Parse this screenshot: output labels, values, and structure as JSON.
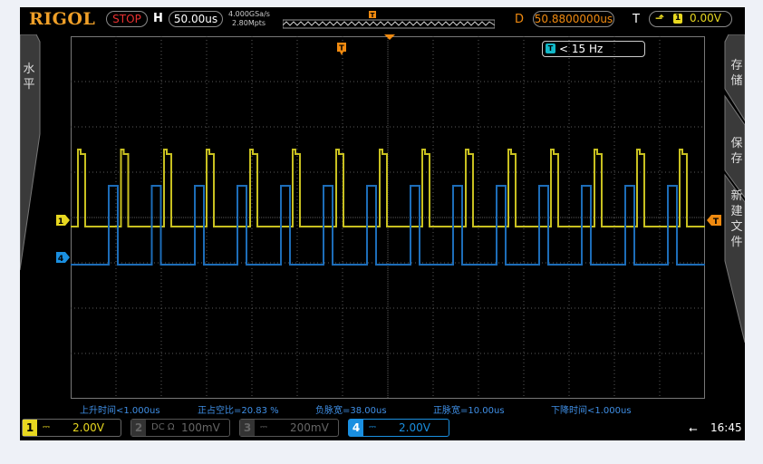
{
  "brand": "RIGOL",
  "run_state": "STOP",
  "horizontal": {
    "label": "H",
    "timebase": "50.00us",
    "sample_rate": "4.000GSa/s",
    "memory_depth": "2.80Mpts"
  },
  "delay": {
    "label": "D",
    "value": "50.8800000us"
  },
  "trigger": {
    "label": "T",
    "edge_icon": "rising-edge-icon",
    "source": "1",
    "level": "0.00V"
  },
  "frequency_counter": {
    "marker": "T",
    "value": "< 15 Hz"
  },
  "left_menu": {
    "label": "水平"
  },
  "right_menu": {
    "items": [
      "存储",
      "保存",
      "新建文件"
    ]
  },
  "markers": {
    "trigger_position": "T",
    "ch1": "1",
    "ch4": "4",
    "trigger_level": "T"
  },
  "measurements": [
    "上升时间<1.000us",
    "正占空比=20.83 %",
    "负脉宽=38.00us",
    "正脉宽=10.00us",
    "下降时间<1.000us"
  ],
  "channels": [
    {
      "num": "1",
      "coupling": "DC",
      "scale": "2.00V",
      "active": true,
      "color": "#e8d820"
    },
    {
      "num": "2",
      "coupling": "DC Ω",
      "scale": "100mV",
      "active": false,
      "color": "#555555"
    },
    {
      "num": "3",
      "coupling": "DC",
      "scale": "200mV",
      "active": false,
      "color": "#555555"
    },
    {
      "num": "4",
      "coupling": "DC",
      "scale": "2.00V",
      "active": true,
      "color": "#1a8fe0"
    }
  ],
  "time": "16:45",
  "colors": {
    "ch1": "#c8c020",
    "ch4": "#1d6db8",
    "accent": "#f08a10",
    "grid": "#5a5a5a"
  }
}
